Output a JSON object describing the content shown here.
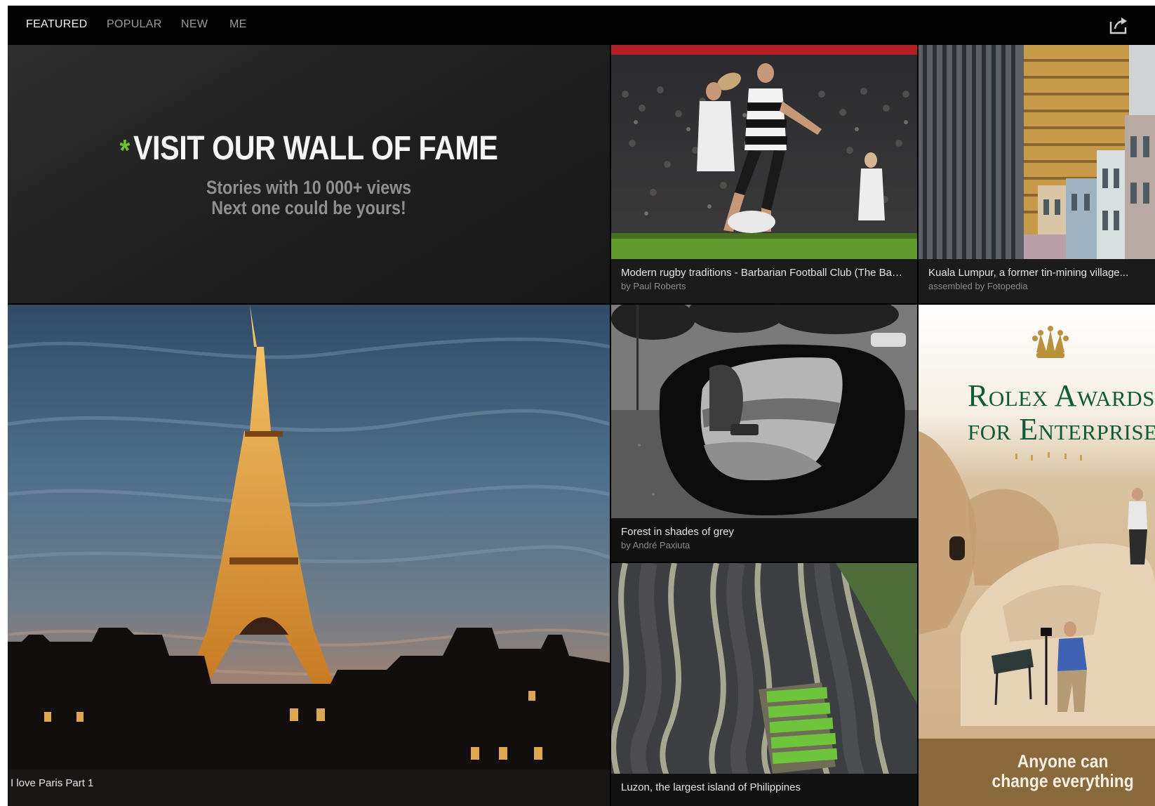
{
  "nav": {
    "tabs": [
      {
        "label": "FEATURED",
        "active": true
      },
      {
        "label": "POPULAR",
        "active": false
      },
      {
        "label": "NEW",
        "active": false
      },
      {
        "label": "ME",
        "active": false
      }
    ],
    "share_icon": "share-icon"
  },
  "fame": {
    "star": "*",
    "title": "VISIT OUR WALL OF FAME",
    "subtitle_line1": "Stories with 10 000+ views",
    "subtitle_line2": "Next one could be yours!",
    "accent_color": "#6fc12b"
  },
  "stories": {
    "rugby": {
      "title": "Modern rugby traditions - Barbarian Football Club (The Baa-Baas)",
      "author": "by Paul Roberts"
    },
    "kuala_lumpur": {
      "title": "Kuala Lumpur, a former tin-mining village...",
      "author": "assembled by Fotopedia"
    },
    "paris": {
      "title": "I love Paris Part 1"
    },
    "forest": {
      "title": "Forest in shades of grey",
      "author": "by André Paxiuta"
    },
    "luzon": {
      "title": "Luzon, the largest island of Philippines"
    }
  },
  "ad": {
    "title_line1": "Rolex Awards",
    "title_line2": "for Enterprise",
    "tagline": "Anyone can change everything",
    "brand_color": "#0f5a3a",
    "band_color": "#8a6a3d"
  }
}
